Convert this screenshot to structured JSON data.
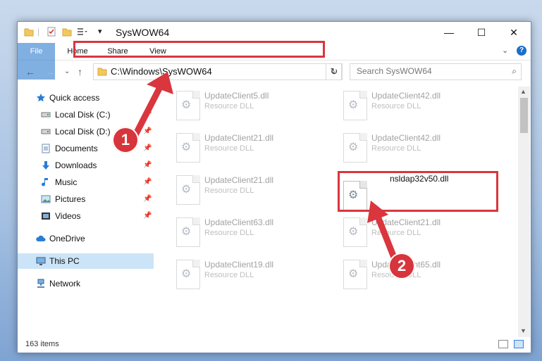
{
  "window": {
    "title": "SysWOW64",
    "controls": {
      "minimize": "—",
      "maximize": "☐",
      "close": "✕"
    }
  },
  "ribbon": {
    "tabs": [
      {
        "label": "File"
      },
      {
        "label": "Home"
      },
      {
        "label": "Share"
      },
      {
        "label": "View"
      }
    ]
  },
  "navigation": {
    "address": "C:\\Windows\\SysWOW64",
    "search_placeholder": "Search SysWOW64"
  },
  "sidebar": {
    "items": [
      {
        "label": "Quick access",
        "icon": "star-icon"
      },
      {
        "label": "Local Disk (C:)",
        "icon": "drive-icon",
        "pinned": true
      },
      {
        "label": "Local Disk (D:)",
        "icon": "drive-icon",
        "pinned": true
      },
      {
        "label": "Documents",
        "icon": "documents-icon",
        "pinned": true
      },
      {
        "label": "Downloads",
        "icon": "downloads-icon",
        "pinned": true
      },
      {
        "label": "Music",
        "icon": "music-icon",
        "pinned": true
      },
      {
        "label": "Pictures",
        "icon": "pictures-icon",
        "pinned": true
      },
      {
        "label": "Videos",
        "icon": "videos-icon",
        "pinned": true
      },
      {
        "label": "OneDrive",
        "icon": "cloud-icon"
      },
      {
        "label": "This PC",
        "icon": "computer-icon",
        "selected": true
      },
      {
        "label": "Network",
        "icon": "network-icon"
      }
    ]
  },
  "files": [
    {
      "name": "UpdateClient5.dll",
      "desc": "Resource DLL"
    },
    {
      "name": "UpdateClient42.dll",
      "desc": "Resource DLL"
    },
    {
      "name": "UpdateClient21.dll",
      "desc": "Resource DLL"
    },
    {
      "name": "UpdateClient42.dll",
      "desc": "Resource DLL"
    },
    {
      "name": "UpdateClient21.dll",
      "desc": "Resource DLL"
    },
    {
      "name": "nsldap32v50.dll",
      "desc": ""
    },
    {
      "name": "UpdateClient63.dll",
      "desc": "Resource DLL"
    },
    {
      "name": "UpdateClient21.dll",
      "desc": "Resource DLL"
    },
    {
      "name": "UpdateClient19.dll",
      "desc": "Resource DLL"
    },
    {
      "name": "UpdateClient65.dll",
      "desc": "Resource DLL"
    }
  ],
  "status": {
    "item_count": "163 items"
  },
  "annotations": {
    "step1": "1",
    "step2": "2"
  },
  "colors": {
    "accent": "#1a6fc9",
    "highlight": "#d9363e",
    "selection": "#cce4f7"
  }
}
